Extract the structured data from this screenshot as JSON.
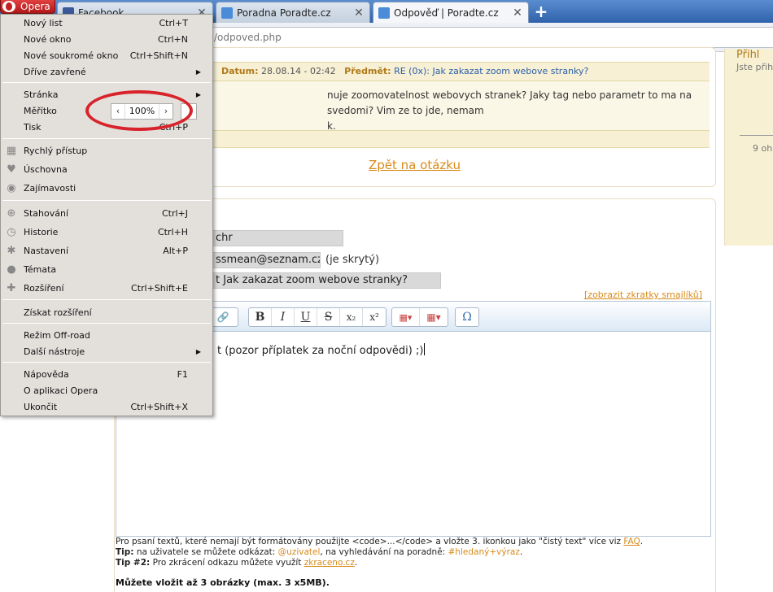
{
  "tabs": [
    {
      "title": "Facebook",
      "favicon_color": "#3b5998"
    },
    {
      "title": "Poradna Poradte.cz",
      "favicon_color": "#4a8cd8"
    },
    {
      "title": "Odpověď | Poradte.cz",
      "favicon_color": "#4a8cd8",
      "active": true
    }
  ],
  "opera_button": "Opera",
  "address": "/odpoved.php",
  "question": {
    "date_label": "Datum:",
    "date": "28.08.14 - 02:42",
    "subject_label": "Předmět:",
    "subject": "RE (0x): Jak zakazat zoom webove stranky?",
    "body_line1": "nuje zoomovatelnost webovych stranek? Jaky tag nebo parametr to ma na svedomi? Vim ze to jde, nemam",
    "body_line2": "k."
  },
  "back_link": "Zpět na otázku",
  "sidebar": {
    "header": "Přihl",
    "login_text": "Jste přihlá",
    "count": "9 oh"
  },
  "form": {
    "name_value": "chr",
    "email_value": "ssmean@seznam.cz",
    "email_note": "(je skrytý)",
    "subject_value": "t Jak zakazat zoom webove stranky?",
    "smiley_link": "[zobrazit zkratky smajlíků]",
    "editor_text": "t (pozor příplatek za noční odpovědi) ;)"
  },
  "toolbar": {
    "bold": "B",
    "italic": "I",
    "underline": "U",
    "strike": "S",
    "subscript": "x₂",
    "superscript": "x²",
    "omega": "Ω"
  },
  "help": {
    "line1_a": "Pro psaní textů, které nemají být formátovány použijte <code>...</code> a vložte 3. ikonkou jako \"čistý text\" více viz ",
    "faq": "FAQ",
    "tip_label": "Tip:",
    "tip_text_a": " na uživatele se můžete odkázat: ",
    "tip_user": "@uzivatel",
    "tip_text_b": ", na vyhledávání na poradně: ",
    "tip_search": "#hledaný+výraz",
    "tip2_label": "Tip #2:",
    "tip2_text": " Pro zkrácení odkazu můžete využít ",
    "tip2_link": "zkraceno.cz"
  },
  "upload_note": "Můžete vložit až 3 obrázky (max. 3 x5MB).",
  "menu": {
    "new_tab": {
      "label": "Nový list",
      "shortcut": "Ctrl+T"
    },
    "new_window": {
      "label": "Nové okno",
      "shortcut": "Ctrl+N"
    },
    "private_window": {
      "label": "Nové soukromé okno",
      "shortcut": "Ctrl+Shift+N"
    },
    "recently_closed": {
      "label": "Dříve zavřené"
    },
    "page": {
      "label": "Stránka"
    },
    "zoom": {
      "label": "Měřítko",
      "value": "100%"
    },
    "print": {
      "label": "Tisk",
      "shortcut": "Ctrl+P"
    },
    "speed_dial": {
      "label": "Rychlý přístup"
    },
    "stash": {
      "label": "Úschovna"
    },
    "discover": {
      "label": "Zajímavosti"
    },
    "downloads": {
      "label": "Stahování",
      "shortcut": "Ctrl+J"
    },
    "history": {
      "label": "Historie",
      "shortcut": "Ctrl+H"
    },
    "settings": {
      "label": "Nastavení",
      "shortcut": "Alt+P"
    },
    "themes": {
      "label": "Témata"
    },
    "extensions": {
      "label": "Rozšíření",
      "shortcut": "Ctrl+Shift+E"
    },
    "get_extensions": {
      "label": "Získat rozšíření"
    },
    "off_road": {
      "label": "Režim Off-road"
    },
    "more_tools": {
      "label": "Další nástroje"
    },
    "help": {
      "label": "Nápověda",
      "shortcut": "F1"
    },
    "about": {
      "label": "O aplikaci Opera"
    },
    "exit": {
      "label": "Ukončit",
      "shortcut": "Ctrl+Shift+X"
    }
  },
  "colors": {
    "accent_orange": "#d88a1a",
    "tab_bar_blue": "#3c6fb5",
    "annotation_red": "#d8232a"
  }
}
